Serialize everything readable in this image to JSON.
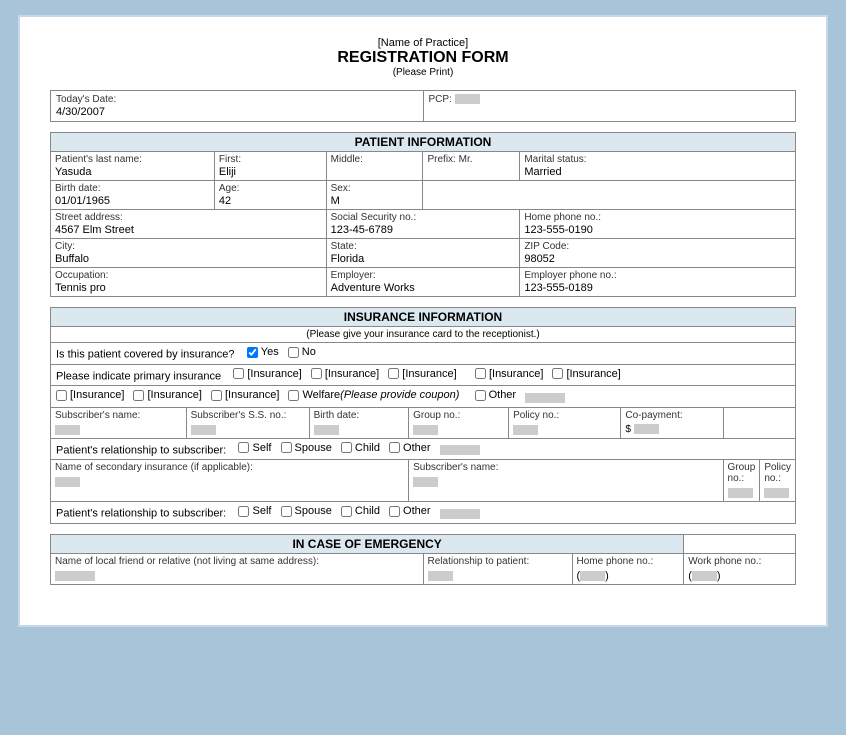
{
  "header": {
    "practice_name": "[Name of Practice]",
    "title": "REGISTRATION FORM",
    "subtitle": "(Please Print)"
  },
  "top": {
    "date_label": "Today's Date:",
    "date_value": "4/30/2007",
    "pcp_label": "PCP:"
  },
  "patient": {
    "section_title": "PATIENT INFORMATION",
    "last_name_label": "Patient's last name:",
    "last_name": "Yasuda",
    "first_label": "First:",
    "first_name": "Eliji",
    "middle_label": "Middle:",
    "middle_value": "",
    "prefix_label": "Prefix:",
    "prefix_value": "Mr.",
    "marital_label": "Marital status:",
    "marital_value": "Married",
    "birth_label": "Birth date:",
    "birth_value": "01/01/1965",
    "age_label": "Age:",
    "age_value": "42",
    "sex_label": "Sex:",
    "sex_value": "M",
    "address_label": "Street address:",
    "address_value": "4567 Elm Street",
    "ssn_label": "Social Security no.:",
    "ssn_value": "123-45-6789",
    "home_phone_label": "Home phone no.:",
    "home_phone_value": "123-555-0190",
    "city_label": "City:",
    "city_value": "Buffalo",
    "state_label": "State:",
    "state_value": "Florida",
    "zip_label": "ZIP Code:",
    "zip_value": "98052",
    "occupation_label": "Occupation:",
    "occupation_value": "Tennis pro",
    "employer_label": "Employer:",
    "employer_value": "Adventure Works",
    "employer_phone_label": "Employer phone no.:",
    "employer_phone_value": "123-555-0189"
  },
  "insurance": {
    "section_title": "INSURANCE INFORMATION",
    "section_note": "(Please give your insurance card to the receptionist.)",
    "covered_label": "Is this patient covered by insurance?",
    "yes_label": "Yes",
    "no_label": "No",
    "primary_label": "Please indicate primary insurance",
    "ins_options": [
      "[Insurance]",
      "[Insurance]",
      "[Insurance]",
      "[Insurance]",
      "[Insurance]",
      "[Insurance]",
      "[Insurance]",
      "[Insurance]"
    ],
    "welfare_label": "Welfare",
    "welfare_note": "(Please provide coupon)",
    "other_label": "Other",
    "subscriber_name_label": "Subscriber's name:",
    "subscriber_ss_label": "Subscriber's S.S. no.:",
    "birth_date_label": "Birth date:",
    "group_no_label": "Group no.:",
    "policy_no_label": "Policy no.:",
    "copay_label": "Co-payment:",
    "copay_dollar": "$",
    "relationship_label": "Patient's relationship to subscriber:",
    "self_label": "Self",
    "spouse_label": "Spouse",
    "child_label": "Child",
    "other_rel_label": "Other",
    "secondary_label": "Name of secondary insurance (if applicable):",
    "secondary_subscriber_label": "Subscriber's name:",
    "secondary_group_label": "Group no.:",
    "secondary_policy_label": "Policy no.:",
    "relationship2_label": "Patient's relationship to subscriber:",
    "self2_label": "Self",
    "spouse2_label": "Spouse",
    "child2_label": "Child",
    "other2_label": "Other"
  },
  "emergency": {
    "section_title": "IN CASE OF EMERGENCY",
    "friend_label": "Name of local friend or relative (not living at same address):",
    "relationship_label": "Relationship to patient:",
    "home_phone_label": "Home phone no.:",
    "home_phone_format": "(",
    "work_phone_label": "Work phone no.:",
    "work_phone_format": "("
  }
}
